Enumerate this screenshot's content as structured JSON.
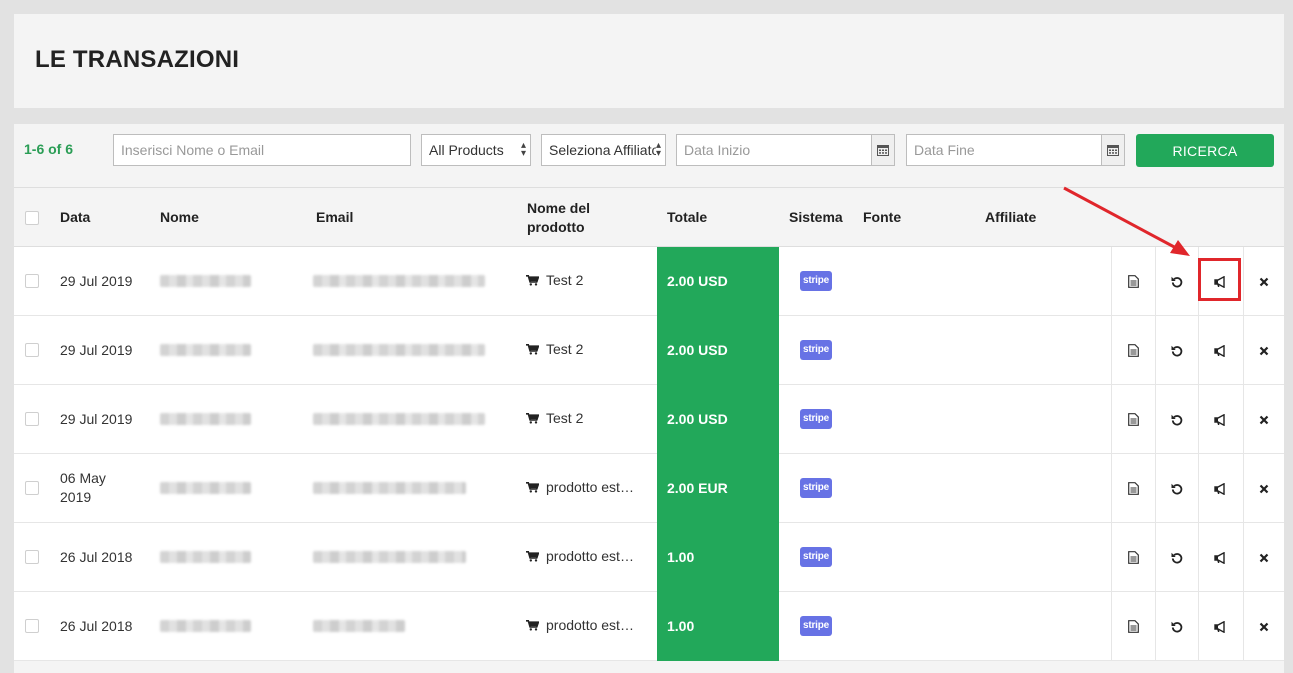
{
  "header": {
    "title": "LE TRANSAZIONI"
  },
  "filters": {
    "count": "1-6 of 6",
    "search_placeholder": "Inserisci Nome o Email",
    "products_value": "All Products",
    "affiliate_value": "Seleziona Affiliato",
    "start_placeholder": "Data Inizio",
    "end_placeholder": "Data Fine",
    "search_button": "RICERCA"
  },
  "table": {
    "columns": {
      "date": "Data",
      "name": "Nome",
      "email": "Email",
      "product_line1": "Nome del",
      "product_line2": "prodotto",
      "total": "Totale",
      "system": "Sistema",
      "source": "Fonte",
      "affiliate": "Affiliate"
    },
    "rows": [
      {
        "date": "29 Jul 2019",
        "date2": "",
        "product": "Test 2",
        "total": "2.00 USD",
        "system": "stripe"
      },
      {
        "date": "29 Jul 2019",
        "date2": "",
        "product": "Test 2",
        "total": "2.00 USD",
        "system": "stripe"
      },
      {
        "date": "29 Jul 2019",
        "date2": "",
        "product": "Test 2",
        "total": "2.00 USD",
        "system": "stripe"
      },
      {
        "date": "06 May",
        "date2": "2019",
        "product": "prodotto est…",
        "total": "2.00 EUR",
        "system": "stripe"
      },
      {
        "date": "26 Jul 2018",
        "date2": "",
        "product": "prodotto est…",
        "total": "1.00",
        "system": "stripe"
      },
      {
        "date": "26 Jul 2018",
        "date2": "",
        "product": "prodotto est…",
        "total": "1.00",
        "system": "stripe"
      }
    ]
  },
  "colors": {
    "accent_green": "#22a85a",
    "stripe": "#6772e5",
    "annotation_red": "#e0262b"
  },
  "icons": [
    "calendar-icon",
    "cart-icon",
    "invoice-icon",
    "refund-icon",
    "megaphone-icon",
    "delete-icon",
    "select-arrows-icon"
  ]
}
